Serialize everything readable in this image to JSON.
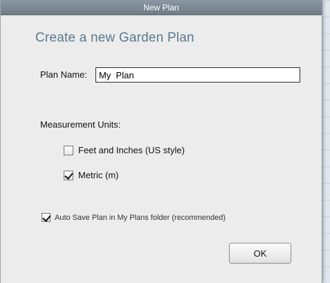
{
  "window": {
    "title": "New Plan"
  },
  "dialog": {
    "heading": "Create a new Garden Plan",
    "plan_name_label": "Plan Name:",
    "plan_name_value": "My  Plan",
    "units_label": "Measurement Units:",
    "units": [
      {
        "label": "Feet and Inches (US style)",
        "checked": false
      },
      {
        "label": "Metric (m)",
        "checked": true
      }
    ],
    "autosave": {
      "label": "Auto Save Plan in My Plans folder (recommended)",
      "checked": true
    },
    "ok_label": "OK"
  }
}
